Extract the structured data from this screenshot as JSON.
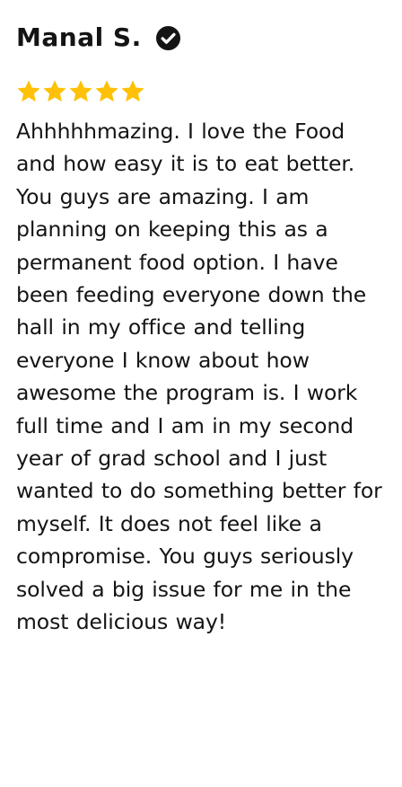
{
  "review": {
    "reviewer_name": "Manal S.",
    "verified_icon": "check-circle-icon",
    "rating": 5,
    "rating_max": 5,
    "star_color": "#FFC107",
    "text": "Ahhhhhmazing. I love the Food and how easy it is to eat better. You guys are amazing. I am planning on keeping this as a permanent food option. I have been feeding everyone down the hall in my office and telling everyone I know about how awesome the program is. I work full time and I am in my second year of grad school and I just wanted to do something better for myself. It does not feel like a compromise. You guys seriously solved a big issue for me in the most delicious way!"
  }
}
